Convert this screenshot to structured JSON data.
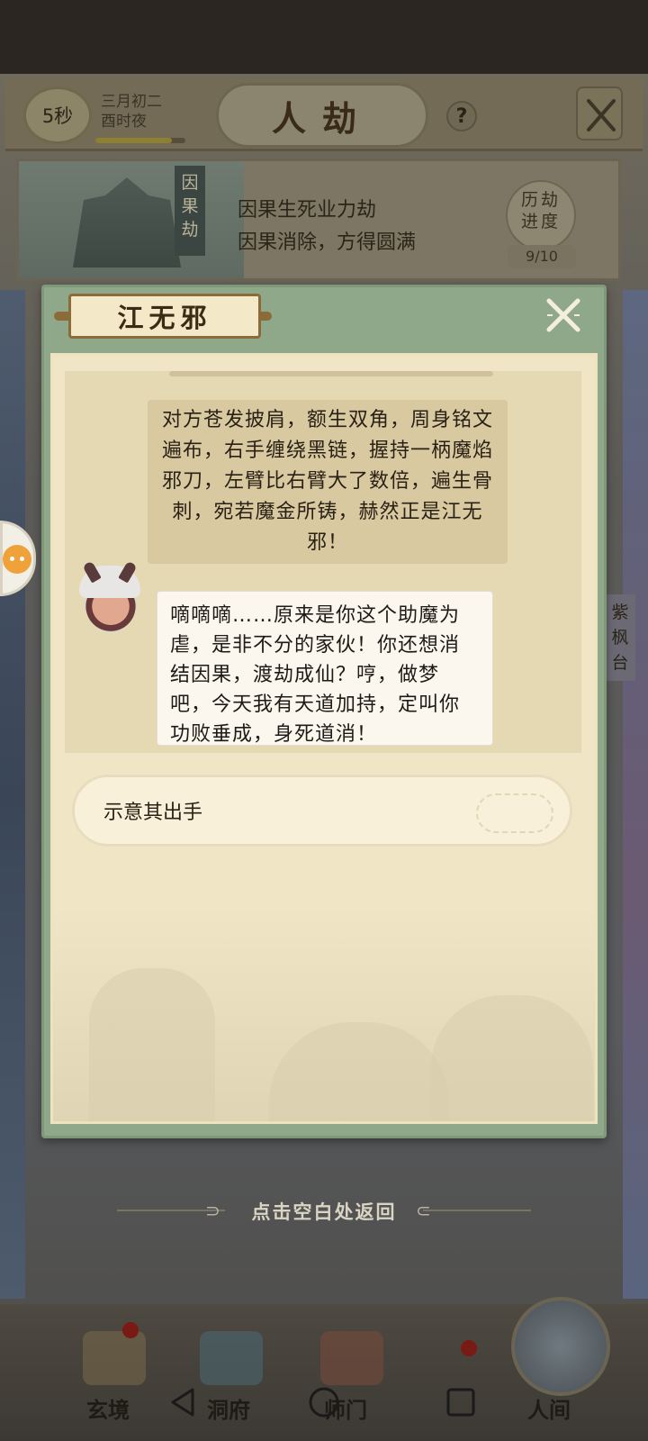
{
  "header": {
    "timer": "5秒",
    "date_line1": "三月初二",
    "date_line2": "酉时夜",
    "day_progress": 0.85,
    "title": "人劫",
    "help_symbol": "?"
  },
  "banner": {
    "tag": "因果劫",
    "line1": "因果生死业力劫",
    "line2": "因果消除，方得圆满",
    "progress_label": "历劫进度",
    "progress_value": "9/10"
  },
  "side": {
    "right_tag": "紫枫台"
  },
  "dialog": {
    "speaker_name": "江无邪",
    "narration": "对方苍发披肩，额生双角，周身铭文遍布，右手缠绕黑链，握持一柄魔焰邪刀，左臂比右臂大了数倍，遍生骨刺，宛若魔金所铸，赫然正是江无邪！",
    "speech": "嘀嘀嘀……原来是你这个助魔为虐，是非不分的家伙！你还想消结因果，渡劫成仙？哼，做梦吧，今天我有天道加持，定叫你功败垂成，身死道消！",
    "choice": "示意其出手"
  },
  "return_hint": "点击空白处返回",
  "bottom_tabs": [
    "玄境",
    "洞府",
    "师门",
    "人间"
  ],
  "colors": {
    "dialog_frame": "#8fa88a",
    "dialog_paper": "#f0e6c5",
    "name_plate_border": "#8b6b3a"
  }
}
